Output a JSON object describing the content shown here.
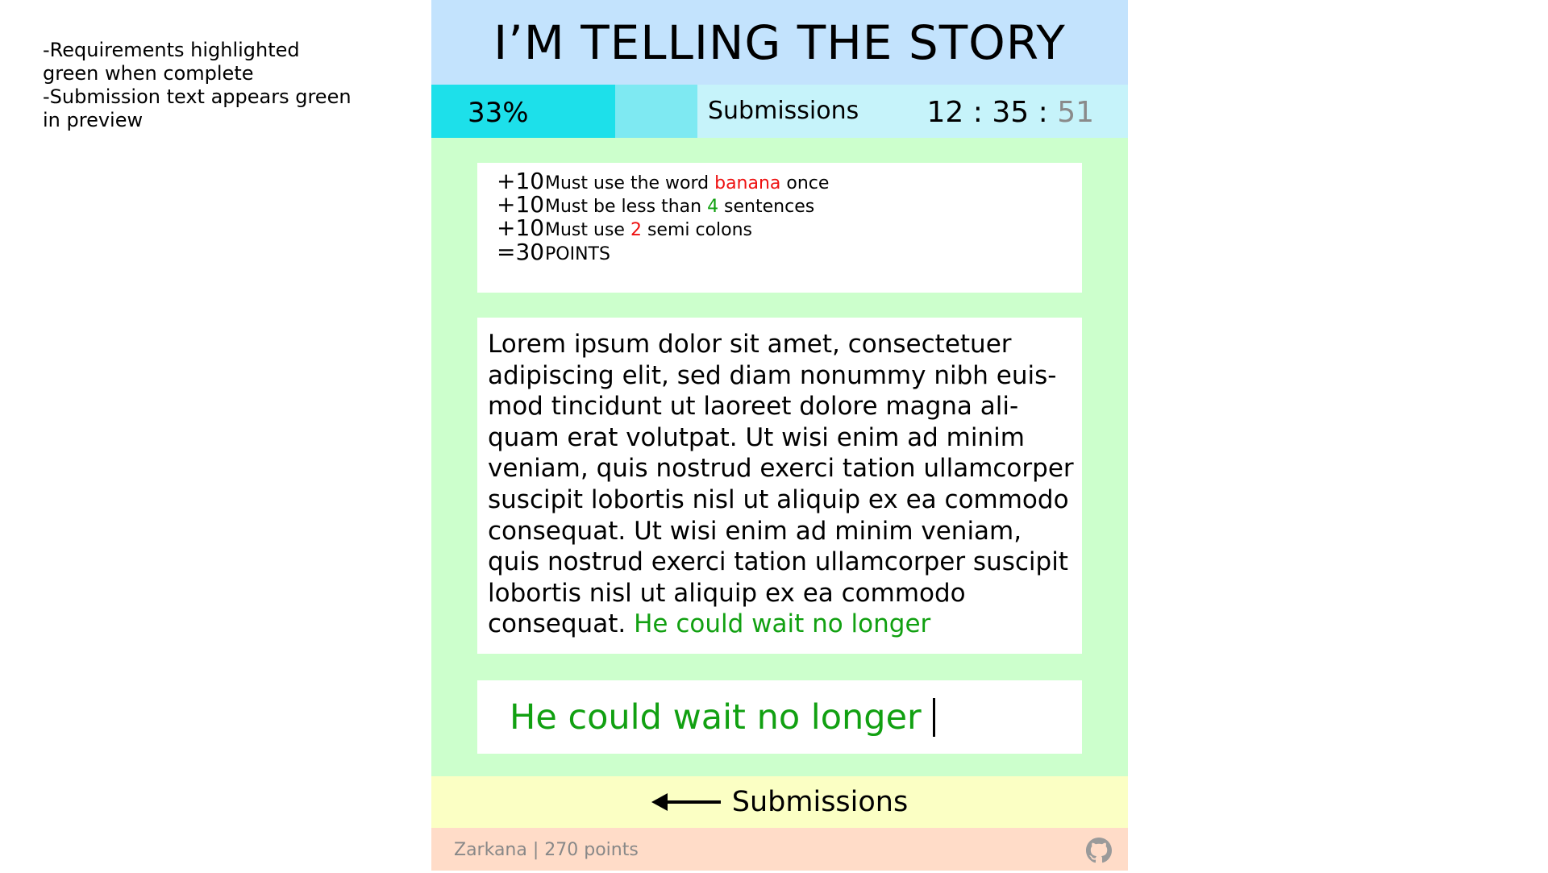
{
  "notes": [
    "-Requirements highlighted\ngreen when complete",
    "-Submission text appears green\nin preview"
  ],
  "header": {
    "title": "I’M TELLING THE STORY"
  },
  "status": {
    "progress_label": "33%",
    "progress_fraction": 0.69,
    "submissions_label": "Submissions",
    "timer": {
      "hours": "12",
      "sep1": " : ",
      "minutes": "35",
      "sep2": " : ",
      "seconds": "51"
    }
  },
  "requirements": [
    {
      "points": "+10",
      "before": "Must use the word ",
      "highlight": "banana",
      "after": " once",
      "highlight_color": "#ee1111"
    },
    {
      "points": "+10",
      "before": "Must be less than ",
      "highlight": "4",
      "after": " sentences",
      "highlight_color": "#11a011"
    },
    {
      "points": "+10",
      "before": "Must use ",
      "highlight": "2",
      "after": " semi colons",
      "highlight_color": "#ee1111"
    },
    {
      "points": "=30",
      "before": "POINTS",
      "highlight": "",
      "after": "",
      "highlight_color": "#000000"
    }
  ],
  "story": {
    "text": "Lorem ipsum dolor sit amet, consectetuer adipiscing elit, sed diam nonummy nibh euis­mod tincidunt ut laoreet dolore magna ali­quam erat volutpat. Ut wisi enim ad minim veniam, quis nostrud exerci tation ullamcorp­er suscipit lobortis nisl ut aliquip ex ea com­modo consequat. Ut wisi enim ad minim veniam, quis nostrud exerci tation ullamcorp­er suscipit lobortis nisl ut aliquip ex ea com­modo consequat. ",
    "preview": "He could wait no longer"
  },
  "input": {
    "value": "He could wait no longer"
  },
  "nav": {
    "label": "Submissions",
    "icon": "arrow-left-icon"
  },
  "footer": {
    "user": "Zarkana | 270 points",
    "icon": "github-icon"
  },
  "colors": {
    "header_bg": "#c3e3fd",
    "status_bg": "#c6f3fa",
    "progress_fill": "#1de0ea",
    "main_bg": "#ccffcc",
    "nav_bg": "#fbffc4",
    "footer_bg": "#ffdcc8",
    "success": "#11a011",
    "fail": "#ee1111"
  }
}
